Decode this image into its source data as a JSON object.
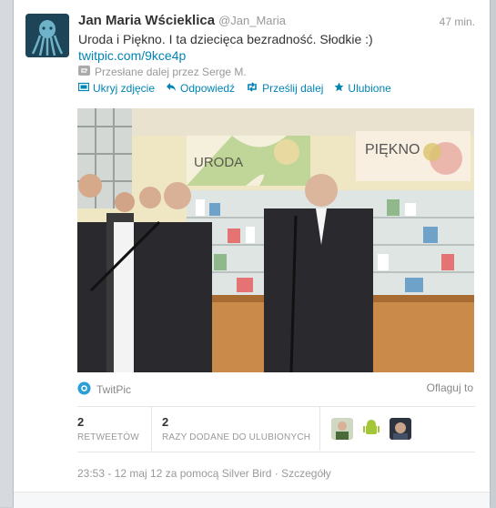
{
  "tweet": {
    "author_name": "Jan Maria Wścieklica",
    "author_handle": "@Jan_Maria",
    "time": "47 min.",
    "text": "Uroda i Piękno. I ta dziecięca bezradność. Słodkie :)",
    "link": "twitpic.com/9kce4p",
    "retweeted_by": "Przesłane dalej przez Serge M."
  },
  "actions": {
    "hide_photo": "Ukryj zdjęcie",
    "reply": "Odpowiedź",
    "retweet": "Prześlij dalej",
    "favorite": "Ulubione"
  },
  "photo": {
    "sign_left": "URODA",
    "sign_right": "PIĘKNO"
  },
  "media": {
    "provider": "TwitPic",
    "flag": "Oflaguj to"
  },
  "stats": {
    "retweets_count": "2",
    "retweets_label": "RETWEETÓW",
    "favorites_count": "2",
    "favorites_label": "RAZY DODANE DO ULUBIONYCH"
  },
  "meta": {
    "timestamp": "23:53 - 12 maj 12 za pomocą Silver Bird · Szczegóły"
  },
  "icons": {
    "photo": "photo-icon",
    "reply": "reply-arrow-icon",
    "retweet": "retweet-icon",
    "favorite": "star-icon",
    "twitpic": "twitpic-logo-icon"
  },
  "colors": {
    "link": "#0084b4",
    "text": "#333333",
    "muted": "#999999"
  }
}
